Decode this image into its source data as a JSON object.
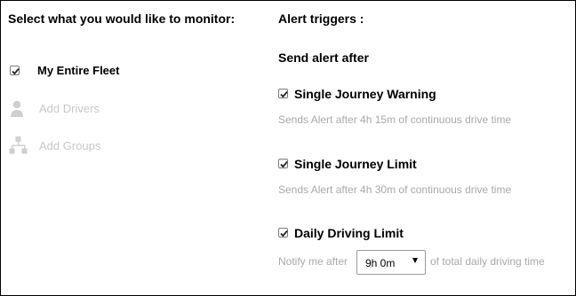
{
  "monitor": {
    "title": "Select what you would like to monitor:",
    "entire_fleet": {
      "label": "My Entire Fleet",
      "checked": true
    },
    "add_drivers": {
      "label": "Add Drivers",
      "icon": "person-icon"
    },
    "add_groups": {
      "label": "Add Groups",
      "icon": "hierarchy-icon"
    }
  },
  "alerts": {
    "title": "Alert triggers :",
    "subtitle": "Send alert after",
    "triggers": [
      {
        "label": "Single Journey Warning",
        "checked": true,
        "description": "Sends Alert after 4h 15m of continuous drive time"
      },
      {
        "label": "Single Journey Limit",
        "checked": true,
        "description": "Sends Alert after 4h 30m of continuous drive time"
      },
      {
        "label": "Daily Driving Limit",
        "checked": true,
        "notify_prefix": "Notify me after",
        "selected_duration": "9h 0m",
        "notify_suffix": "of total daily driving time"
      }
    ]
  }
}
